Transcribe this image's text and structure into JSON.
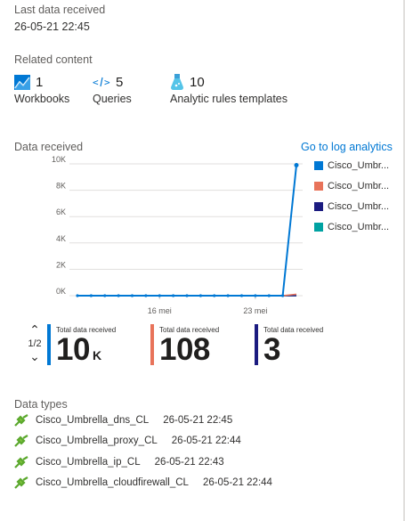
{
  "last_data": {
    "label": "Last data received",
    "value": "26-05-21 22:45"
  },
  "related": {
    "heading": "Related content",
    "items": [
      {
        "count": "1",
        "label": "Workbooks",
        "icon": "workbook-icon"
      },
      {
        "count": "5",
        "label": "Queries",
        "icon": "query-icon"
      },
      {
        "count": "10",
        "label": "Analytic rules templates",
        "icon": "flask-icon"
      }
    ]
  },
  "chart_section": {
    "heading": "Data received",
    "link": "Go to log analytics"
  },
  "chart_data": {
    "type": "line",
    "x_tick_labels": [
      "16 mei",
      "23 mei"
    ],
    "y_tick_labels": [
      "0K",
      "2K",
      "4K",
      "6K",
      "8K",
      "10K"
    ],
    "ylim": [
      0,
      10000
    ],
    "x": [
      "05-10",
      "05-11",
      "05-12",
      "05-13",
      "05-14",
      "05-15",
      "05-16",
      "05-17",
      "05-18",
      "05-19",
      "05-20",
      "05-21",
      "05-22",
      "05-23",
      "05-24",
      "05-25",
      "05-26"
    ],
    "series": [
      {
        "name": "Cisco_Umbr...",
        "color": "#0078d4",
        "values": [
          0,
          0,
          0,
          0,
          0,
          0,
          0,
          0,
          0,
          0,
          0,
          0,
          0,
          0,
          0,
          0,
          9900
        ]
      },
      {
        "name": "Cisco_Umbr...",
        "color": "#e8735a",
        "values": [
          0,
          0,
          0,
          0,
          0,
          0,
          0,
          0,
          0,
          0,
          0,
          0,
          0,
          0,
          0,
          0,
          108
        ]
      },
      {
        "name": "Cisco_Umbr...",
        "color": "#1b1b80",
        "values": [
          0,
          0,
          0,
          0,
          0,
          0,
          0,
          0,
          0,
          0,
          0,
          0,
          0,
          0,
          0,
          0,
          3
        ]
      },
      {
        "name": "Cisco_Umbr...",
        "color": "#00a2a2",
        "values": [
          0,
          0,
          0,
          0,
          0,
          0,
          0,
          0,
          0,
          0,
          0,
          0,
          0,
          0,
          0,
          0,
          0
        ]
      }
    ]
  },
  "pager": {
    "text": "1/2"
  },
  "totals": [
    {
      "title": "Total data received",
      "value": "10",
      "unit": "K",
      "color": "#0078d4"
    },
    {
      "title": "Total data received",
      "value": "108",
      "unit": "",
      "color": "#e8735a"
    },
    {
      "title": "Total data received",
      "value": "3",
      "unit": "",
      "color": "#1b1b80"
    }
  ],
  "data_types": {
    "heading": "Data types",
    "rows": [
      {
        "name": "Cisco_Umbrella_dns_CL",
        "time": "26-05-21 22:45"
      },
      {
        "name": "Cisco_Umbrella_proxy_CL",
        "time": "26-05-21 22:44"
      },
      {
        "name": "Cisco_Umbrella_ip_CL",
        "time": "26-05-21 22:43"
      },
      {
        "name": "Cisco_Umbrella_cloudfirewall_CL",
        "time": "26-05-21 22:44"
      }
    ]
  }
}
